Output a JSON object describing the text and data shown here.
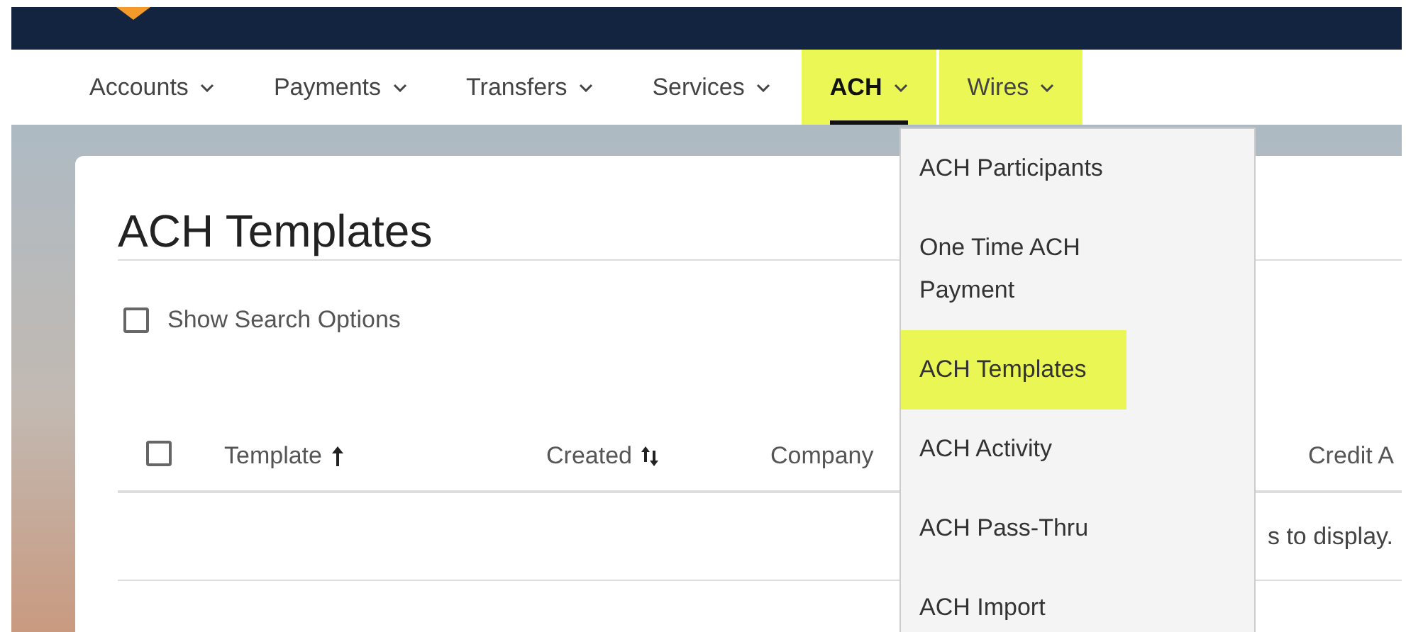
{
  "nav": [
    {
      "label": "Accounts",
      "selected": false,
      "highlighted": false
    },
    {
      "label": "Payments",
      "selected": false,
      "highlighted": false
    },
    {
      "label": "Transfers",
      "selected": false,
      "highlighted": false
    },
    {
      "label": "Services",
      "selected": false,
      "highlighted": false
    },
    {
      "label": "ACH",
      "selected": true,
      "highlighted": true
    },
    {
      "label": "Wires",
      "selected": false,
      "highlighted": true
    }
  ],
  "dropdown": [
    {
      "label": "ACH Participants",
      "highlighted": false
    },
    {
      "label": "One Time ACH Payment",
      "highlighted": false
    },
    {
      "label": "ACH Templates",
      "highlighted": true
    },
    {
      "label": "ACH Activity",
      "highlighted": false
    },
    {
      "label": "ACH Pass-Thru",
      "highlighted": false
    },
    {
      "label": "ACH Import",
      "highlighted": false
    }
  ],
  "page": {
    "title": "ACH Templates",
    "search_options": {
      "label": "Show Search Options",
      "checked": false
    }
  },
  "table": {
    "select_all_checked": false,
    "columns": [
      {
        "label": "Template",
        "kind": "ascending"
      },
      {
        "label": "Created",
        "kind": "sortable"
      },
      {
        "label": "Company",
        "kind": "plain"
      },
      {
        "label": "Credit A",
        "kind": "plain"
      }
    ],
    "empty_message": "s to display."
  }
}
